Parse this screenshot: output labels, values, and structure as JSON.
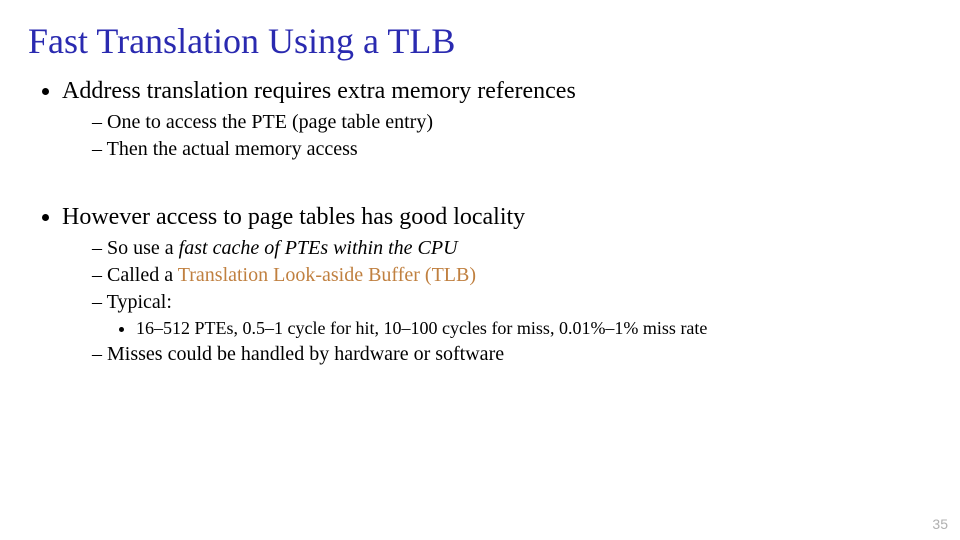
{
  "title": "Fast Translation Using a TLB",
  "bullet1": "Address translation requires extra memory references",
  "sub1a": "One to access the PTE (page table entry)",
  "sub1b": "Then the actual memory access",
  "bullet2": "However access to page tables has good locality",
  "sub2a_prefix": "So use a ",
  "sub2a_italic": "fast cache of PTEs within the CPU",
  "sub2b_prefix": "Called a ",
  "sub2b_accent": "Translation Look-aside Buffer (TLB)",
  "sub2c": "Typical:",
  "sub2c_detail": "16–512 PTEs, 0.5–1 cycle for hit, 10–100 cycles for miss, 0.01%–1% miss rate",
  "sub2d": "Misses could be handled by hardware or software",
  "page_number": "35"
}
